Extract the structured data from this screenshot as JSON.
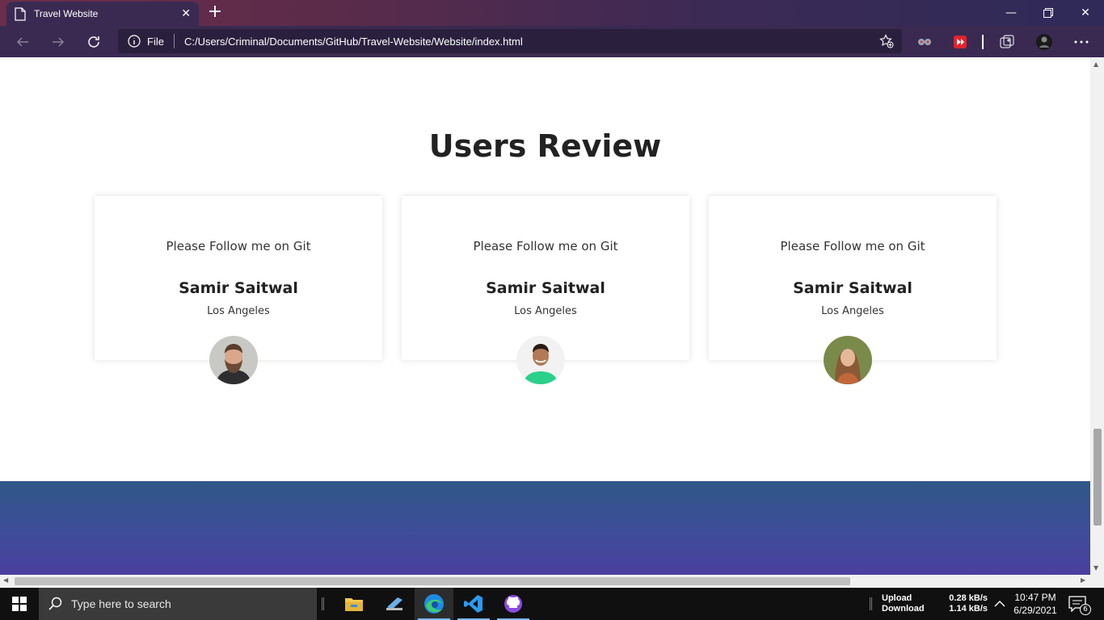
{
  "browser": {
    "tab_title": "Travel Website",
    "address_label": "File",
    "url": "C:/Users/Criminal/Documents/GitHub/Travel-Website/Website/index.html"
  },
  "page": {
    "section_title": "Users Review",
    "reviews": [
      {
        "quote": "Please Follow me on Git",
        "name": "Samir Saitwal",
        "city": "Los Angeles",
        "avatar": "bearded-man-avatar"
      },
      {
        "quote": "Please Follow me on Git",
        "name": "Samir Saitwal",
        "city": "Los Angeles",
        "avatar": "smiling-man-avatar"
      },
      {
        "quote": "Please Follow me on Git",
        "name": "Samir Saitwal",
        "city": "Los Angeles",
        "avatar": "woman-avatar"
      }
    ]
  },
  "taskbar": {
    "search_placeholder": "Type here to search",
    "net_labels": [
      "Upload",
      "Download"
    ],
    "net_values": [
      "0.28 kB/s",
      "1.14 kB/s"
    ],
    "time": "10:47 PM",
    "date": "6/29/2021",
    "notification_count": "6"
  },
  "colors": {
    "footer_band": "#3d4d98",
    "titlebar": "#5b2b4a",
    "toolbar": "#3a2a52"
  }
}
